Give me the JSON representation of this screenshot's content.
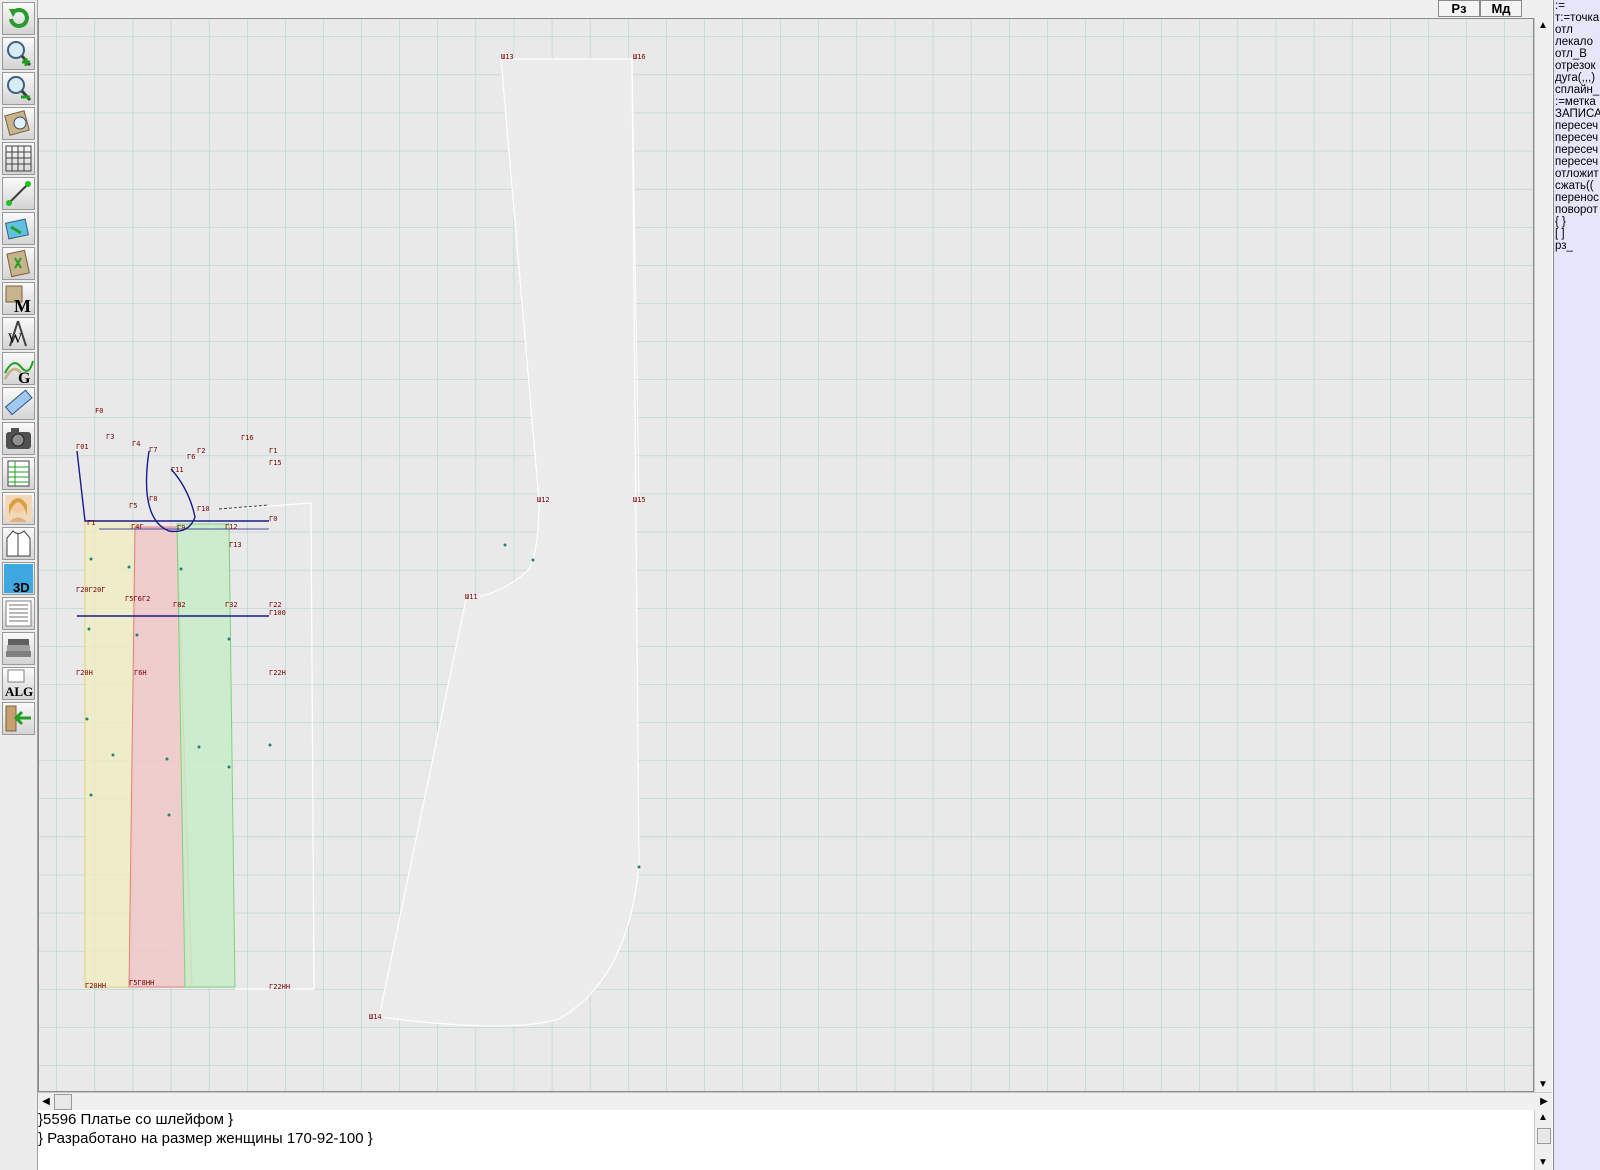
{
  "top_buttons": {
    "rz": "Рз",
    "md": "Мд"
  },
  "toolbar": {
    "items": [
      {
        "name": "refresh-icon"
      },
      {
        "name": "zoom-in-icon"
      },
      {
        "name": "zoom-out-icon"
      },
      {
        "name": "pan-icon"
      },
      {
        "name": "grid-icon"
      },
      {
        "name": "line-icon"
      },
      {
        "name": "layer-icon"
      },
      {
        "name": "pattern-icon"
      },
      {
        "name": "measure-m-icon"
      },
      {
        "name": "compass-w-icon"
      },
      {
        "name": "graph-g-icon"
      },
      {
        "name": "ruler-icon"
      },
      {
        "name": "camera-icon"
      },
      {
        "name": "table-icon"
      },
      {
        "name": "avatar-icon"
      },
      {
        "name": "garment-icon"
      },
      {
        "name": "3d-icon"
      },
      {
        "name": "document-icon"
      },
      {
        "name": "books-icon"
      },
      {
        "name": "alg-icon"
      },
      {
        "name": "exit-icon"
      }
    ],
    "labels": {
      "m": "M",
      "w": "W",
      "g": "G",
      "three_d": "3D",
      "alg": "ALG"
    }
  },
  "command_panel": {
    "lines": [
      ":=",
      "т:=точка",
      "отл",
      "лекало",
      "отл_В",
      "отрезок",
      "дуга(,,,)",
      "сплайн_",
      ":=метка",
      "ЗАПИСА",
      "пересеч",
      "пересеч",
      "пересеч",
      "пересеч",
      "отложит",
      "сжать((",
      "перенос",
      "поворот",
      "{ }",
      "[ ]",
      "рз_"
    ]
  },
  "console": {
    "line1": "}5596  Платье со шлейфом }",
    "line2": "} Разработано на размер женщины 170-92-100 }"
  },
  "drawing": {
    "big_piece_labels": [
      "Ш13",
      "Ш16",
      "Ш12",
      "Ш15",
      "Ш11",
      "Ш14"
    ],
    "small_labels": [
      "F0",
      "Г3",
      "Г4",
      "Г7",
      "Г2",
      "Г6",
      "Г16",
      "Г1",
      "Г15",
      "Г01",
      "Г11",
      "Г8",
      "Г5",
      "Г9",
      "Г10",
      "Г12",
      "Г13",
      "Г4Г",
      "Г20Г20Г",
      "Г5Г6Г2",
      "Г22",
      "Г0",
      "Г20НН",
      "Г5Г8НН",
      "Г22НН",
      "Г1",
      "Г20Н",
      "Г6Н",
      "Г22Н",
      "Г82",
      "Г32",
      "Г100"
    ]
  }
}
